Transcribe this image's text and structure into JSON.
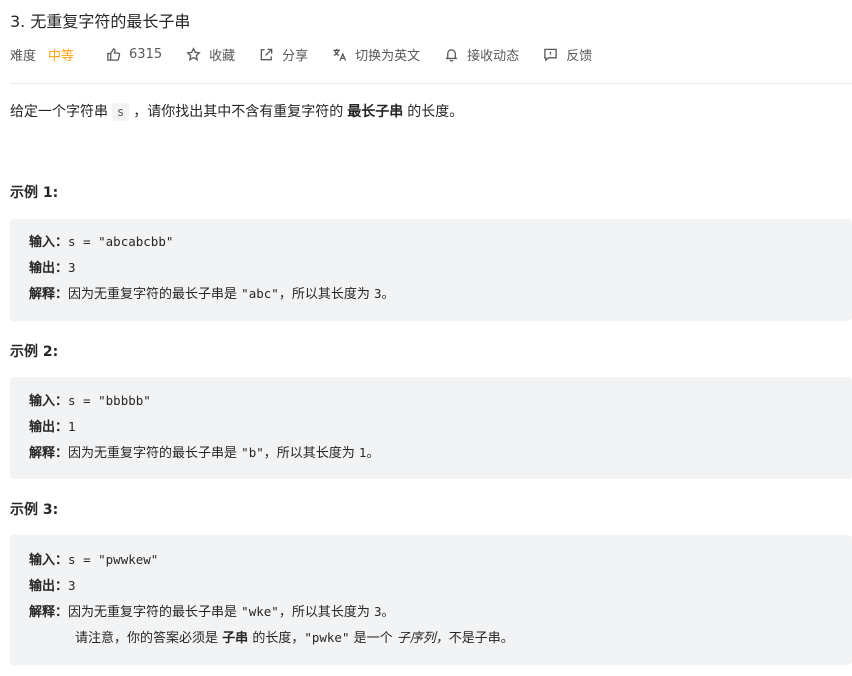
{
  "problem": {
    "title": "3. 无重复字符的最长子串"
  },
  "meta": {
    "difficulty_label": "难度",
    "difficulty_value": "中等",
    "likes": "6315",
    "favorite": "收藏",
    "share": "分享",
    "translate": "切换为英文",
    "notify": "接收动态",
    "feedback": "反馈",
    "colors": {
      "difficulty_medium": "#ffa116",
      "text_secondary": "#595959"
    },
    "icons": [
      "thumbs-up-icon",
      "star-icon",
      "share-icon",
      "translate-icon",
      "bell-icon",
      "feedback-icon"
    ]
  },
  "description": {
    "prefix": "给定一个字符串",
    "var": "s",
    "middle": "，请你找出其中不含有重复字符的",
    "bold": "最长子串",
    "suffix": "的长度。"
  },
  "labels": {
    "input": "输入：",
    "output": "输出：",
    "explanation": "解释："
  },
  "examples": [
    {
      "heading": "示例 1:",
      "input": "s = \"abcabcbb\"",
      "output": "3",
      "explanation_pre": "因为无重复字符的最长子串是",
      "explanation_code": "\"abc\"",
      "explanation_mid": "，所以其长度为",
      "explanation_num": "3",
      "explanation_end": "。"
    },
    {
      "heading": "示例 2:",
      "input": "s = \"bbbbb\"",
      "output": "1",
      "explanation_pre": "因为无重复字符的最长子串是",
      "explanation_code": "\"b\"",
      "explanation_mid": "，所以其长度为",
      "explanation_num": "1",
      "explanation_end": "。"
    },
    {
      "heading": "示例 3:",
      "input": "s = \"pwwkew\"",
      "output": "3",
      "explanation_pre": "因为无重复字符的最长子串是",
      "explanation_code": "\"wke\"",
      "explanation_mid": "，所以其长度为",
      "explanation_num": "3",
      "explanation_end": "。",
      "note_pre": "请注意，你的答案必须是",
      "note_bold": "子串",
      "note_mid": "的长度，",
      "note_code": "\"pwke\"",
      "note_is": "是一个",
      "note_italic": "子序列，",
      "note_end": "不是子串。"
    }
  ]
}
